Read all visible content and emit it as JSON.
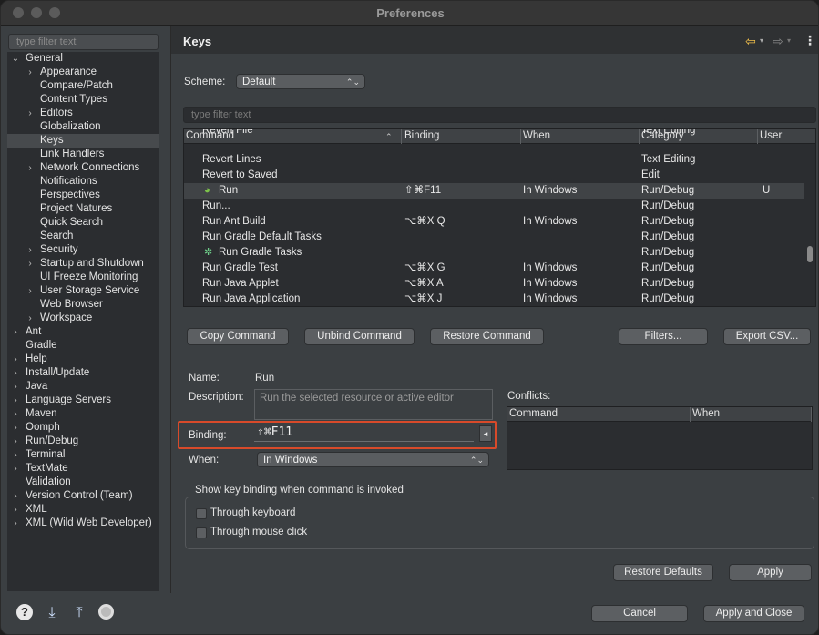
{
  "window": {
    "title": "Preferences"
  },
  "left": {
    "filter_placeholder": "type filter text",
    "tree": [
      {
        "label": "General",
        "arrow": "⌄",
        "level": 0
      },
      {
        "label": "Appearance",
        "arrow": "›",
        "level": 1
      },
      {
        "label": "Compare/Patch",
        "arrow": "",
        "level": 1
      },
      {
        "label": "Content Types",
        "arrow": "",
        "level": 1
      },
      {
        "label": "Editors",
        "arrow": "›",
        "level": 1
      },
      {
        "label": "Globalization",
        "arrow": "",
        "level": 1
      },
      {
        "label": "Keys",
        "arrow": "",
        "level": 1,
        "selected": true
      },
      {
        "label": "Link Handlers",
        "arrow": "",
        "level": 1
      },
      {
        "label": "Network Connections",
        "arrow": "›",
        "level": 1
      },
      {
        "label": "Notifications",
        "arrow": "",
        "level": 1
      },
      {
        "label": "Perspectives",
        "arrow": "",
        "level": 1
      },
      {
        "label": "Project Natures",
        "arrow": "",
        "level": 1
      },
      {
        "label": "Quick Search",
        "arrow": "",
        "level": 1
      },
      {
        "label": "Search",
        "arrow": "",
        "level": 1
      },
      {
        "label": "Security",
        "arrow": "›",
        "level": 1
      },
      {
        "label": "Startup and Shutdown",
        "arrow": "›",
        "level": 1
      },
      {
        "label": "UI Freeze Monitoring",
        "arrow": "",
        "level": 1
      },
      {
        "label": "User Storage Service",
        "arrow": "›",
        "level": 1
      },
      {
        "label": "Web Browser",
        "arrow": "",
        "level": 1
      },
      {
        "label": "Workspace",
        "arrow": "›",
        "level": 1
      },
      {
        "label": "Ant",
        "arrow": "›",
        "level": 0
      },
      {
        "label": "Gradle",
        "arrow": "",
        "level": 0
      },
      {
        "label": "Help",
        "arrow": "›",
        "level": 0
      },
      {
        "label": "Install/Update",
        "arrow": "›",
        "level": 0
      },
      {
        "label": "Java",
        "arrow": "›",
        "level": 0
      },
      {
        "label": "Language Servers",
        "arrow": "›",
        "level": 0
      },
      {
        "label": "Maven",
        "arrow": "›",
        "level": 0
      },
      {
        "label": "Oomph",
        "arrow": "›",
        "level": 0
      },
      {
        "label": "Run/Debug",
        "arrow": "›",
        "level": 0
      },
      {
        "label": "Terminal",
        "arrow": "›",
        "level": 0
      },
      {
        "label": "TextMate",
        "arrow": "›",
        "level": 0
      },
      {
        "label": "Validation",
        "arrow": "",
        "level": 0
      },
      {
        "label": "Version Control (Team)",
        "arrow": "›",
        "level": 0
      },
      {
        "label": "XML",
        "arrow": "›",
        "level": 0
      },
      {
        "label": "XML (Wild Web Developer)",
        "arrow": "›",
        "level": 0
      }
    ]
  },
  "page": {
    "title": "Keys",
    "scheme_label": "Scheme:",
    "scheme_value": "Default",
    "filter_placeholder": "type filter text",
    "columns": [
      "Command",
      "Binding",
      "When",
      "Category",
      "User"
    ],
    "rows": [
      {
        "command": "Revert File",
        "binding": "",
        "when": "",
        "category": "Text Editing",
        "user": ""
      },
      {
        "command": "Revert Lines",
        "binding": "",
        "when": "",
        "category": "Text Editing",
        "user": ""
      },
      {
        "command": "Revert to Saved",
        "binding": "",
        "when": "",
        "category": "Edit",
        "user": ""
      },
      {
        "command": "Run",
        "binding": "⇧⌘F11",
        "when": "In Windows",
        "category": "Run/Debug",
        "user": "U",
        "icon": "run",
        "selected": true
      },
      {
        "command": "Run...",
        "binding": "",
        "when": "",
        "category": "Run/Debug",
        "user": ""
      },
      {
        "command": "Run Ant Build",
        "binding": "⌥⌘X Q",
        "when": "In Windows",
        "category": "Run/Debug",
        "user": ""
      },
      {
        "command": "Run Gradle Default Tasks",
        "binding": "",
        "when": "",
        "category": "Run/Debug",
        "user": ""
      },
      {
        "command": "Run Gradle Tasks",
        "binding": "",
        "when": "",
        "category": "Run/Debug",
        "user": "",
        "icon": "gear"
      },
      {
        "command": "Run Gradle Test",
        "binding": "⌥⌘X G",
        "when": "In Windows",
        "category": "Run/Debug",
        "user": ""
      },
      {
        "command": "Run Java Applet",
        "binding": "⌥⌘X A",
        "when": "In Windows",
        "category": "Run/Debug",
        "user": ""
      },
      {
        "command": "Run Java Application",
        "binding": "⌥⌘X J",
        "when": "In Windows",
        "category": "Run/Debug",
        "user": ""
      }
    ],
    "buttons": {
      "copy": "Copy Command",
      "unbind": "Unbind Command",
      "restore": "Restore Command",
      "filters": "Filters...",
      "export": "Export CSV..."
    },
    "details": {
      "name_label": "Name:",
      "name_value": "Run",
      "description_label": "Description:",
      "description_value": "Run the selected resource or active editor",
      "binding_label": "Binding:",
      "binding_value": "⇧⌘F11",
      "when_label": "When:",
      "when_value": "In Windows",
      "conflicts_label": "Conflicts:",
      "conflict_columns": [
        "Command",
        "When"
      ]
    },
    "show_binding_label": "Show key binding when command is invoked",
    "through_keyboard": "Through keyboard",
    "through_mouse": "Through mouse click",
    "restore_defaults": "Restore Defaults",
    "apply": "Apply"
  },
  "footer": {
    "cancel": "Cancel",
    "apply_close": "Apply and Close"
  }
}
